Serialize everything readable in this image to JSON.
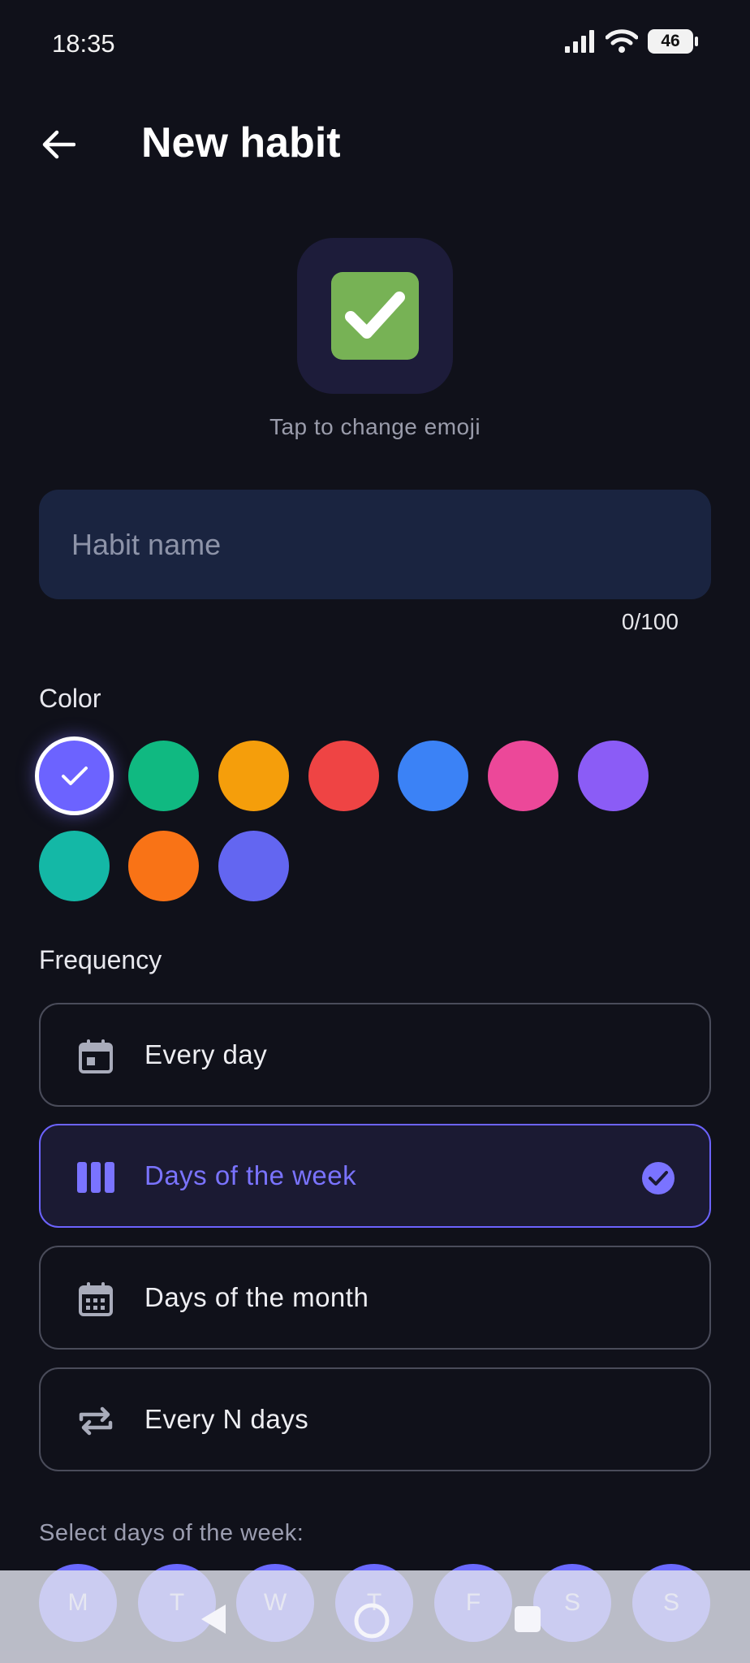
{
  "status_bar": {
    "time": "18:35",
    "battery": "46"
  },
  "header": {
    "title": "New habit"
  },
  "emoji": {
    "hint": "Tap to change emoji"
  },
  "name_field": {
    "placeholder": "Habit name",
    "value": "",
    "counter": "0/100"
  },
  "color_section": {
    "label": "Color",
    "selected_index": 0,
    "swatches": [
      "#6c63ff",
      "#10b981",
      "#f59e0b",
      "#ef4444",
      "#3b82f6",
      "#ec4899",
      "#8b5cf6",
      "#14b8a6",
      "#f97316",
      "#6366f1"
    ]
  },
  "frequency_section": {
    "label": "Frequency",
    "options": [
      {
        "label": "Every day",
        "icon": "calendar-day-icon",
        "selected": false
      },
      {
        "label": "Days of the week",
        "icon": "week-columns-icon",
        "selected": true
      },
      {
        "label": "Days of the month",
        "icon": "calendar-month-icon",
        "selected": false
      },
      {
        "label": "Every N days",
        "icon": "repeat-icon",
        "selected": false
      }
    ]
  },
  "days_section": {
    "label": "Select days of the week:",
    "days": [
      "M",
      "T",
      "W",
      "T",
      "F",
      "S",
      "S"
    ]
  },
  "nav_bar": {
    "icons": [
      "back-triangle-icon",
      "home-circle-icon",
      "recents-square-icon"
    ]
  },
  "accent_color": "#6c63ff"
}
